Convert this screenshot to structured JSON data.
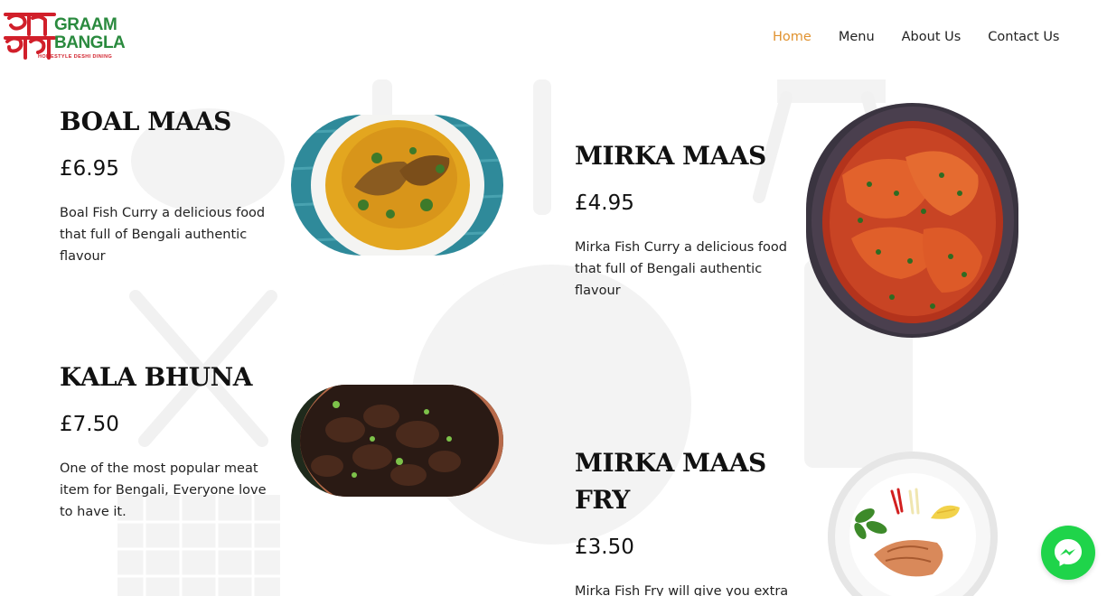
{
  "header": {
    "logo": {
      "bengali_text": "গ্রাম বাংলা",
      "line1": "GRAAM",
      "line2": "BANGLA",
      "tagline": "HOMESTYLE DESHI DINING"
    },
    "nav": [
      {
        "label": "Home",
        "active": true
      },
      {
        "label": "Menu",
        "active": false
      },
      {
        "label": "About Us",
        "active": false
      },
      {
        "label": "Contact Us",
        "active": false
      }
    ]
  },
  "menu_items": [
    {
      "name": "BOAL MAAS",
      "price": "£6.95",
      "description": "Boal Fish Curry a delicious food that full of Bengali authentic flavour",
      "image": "boal-fish-curry-image"
    },
    {
      "name": "MIRKA MAAS",
      "price": "£4.95",
      "description": "Mirka Fish Curry a delicious food that full of Bengali authentic flavour",
      "image": "mirka-fish-curry-image"
    },
    {
      "name": "KALA BHUNA",
      "price": "£7.50",
      "description": "One of the most popular meat item for Bengali, Everyone love to have it.",
      "image": "kala-bhuna-image"
    },
    {
      "name": "MIRKA MAAS FRY",
      "price": "£3.50",
      "description": "Mirka Fish Fry will give you extra",
      "image": "mirka-fish-fry-image"
    }
  ],
  "messenger_button": {
    "icon": "messenger-icon"
  },
  "colors": {
    "accent": "#e0922f",
    "logo_green": "#2a8a3e",
    "logo_red": "#d11f2a",
    "messenger": "#1fd44a"
  }
}
